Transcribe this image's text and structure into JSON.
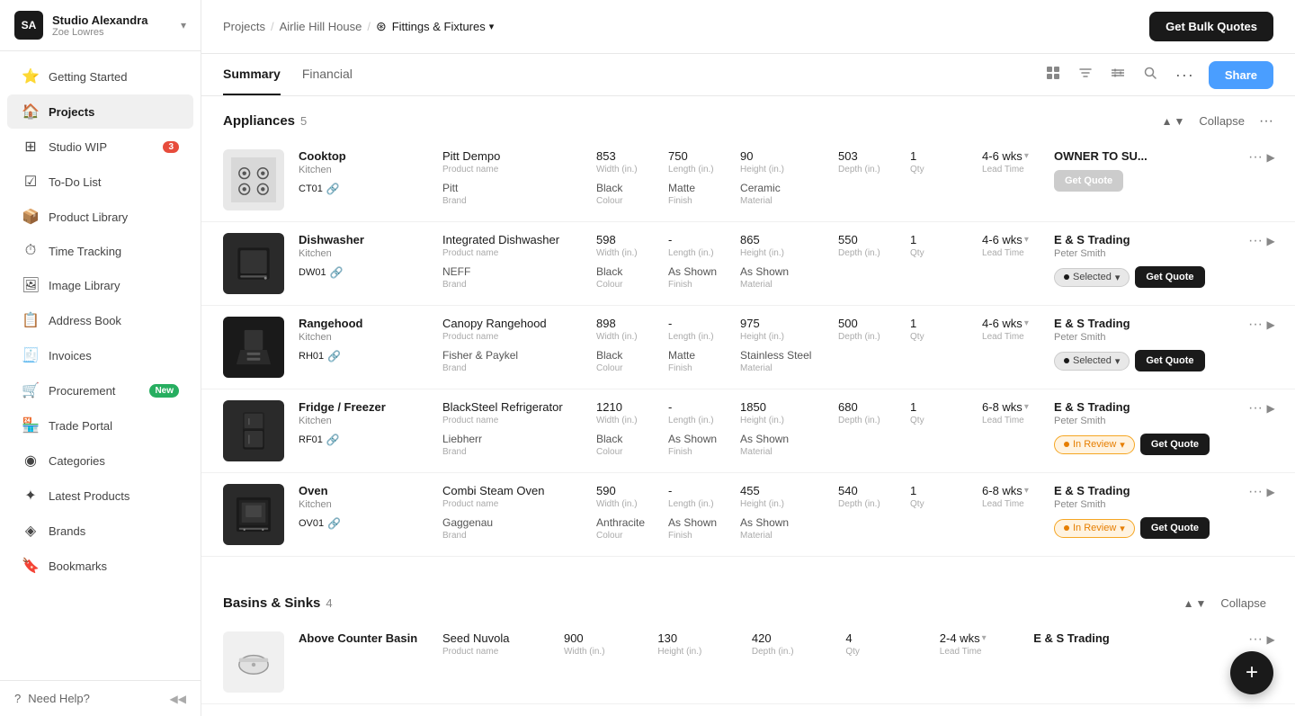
{
  "sidebar": {
    "company": "Studio Alexandra",
    "user": "Zoe Lowres",
    "items": [
      {
        "id": "getting-started",
        "label": "Getting Started",
        "icon": "⭐",
        "badge": null
      },
      {
        "id": "projects",
        "label": "Projects",
        "icon": "🏠",
        "badge": null,
        "active": true
      },
      {
        "id": "studio-wip",
        "label": "Studio WIP",
        "icon": "⊞",
        "badge": "3"
      },
      {
        "id": "todo-list",
        "label": "To-Do List",
        "icon": "☑",
        "badge": null
      },
      {
        "id": "product-library",
        "label": "Product Library",
        "icon": "📦",
        "badge": null
      },
      {
        "id": "time-tracking",
        "label": "Time Tracking",
        "icon": "⏱",
        "badge": null
      },
      {
        "id": "image-library",
        "label": "Image Library",
        "icon": "🖼",
        "badge": null
      },
      {
        "id": "address-book",
        "label": "Address Book",
        "icon": "📋",
        "badge": null
      },
      {
        "id": "invoices",
        "label": "Invoices",
        "icon": "🧾",
        "badge": null
      },
      {
        "id": "procurement",
        "label": "Procurement",
        "icon": "🛒",
        "badge_new": "New"
      },
      {
        "id": "trade-portal",
        "label": "Trade Portal",
        "icon": "🏪",
        "badge": null
      },
      {
        "id": "categories",
        "label": "Categories",
        "icon": "◉",
        "badge": null
      },
      {
        "id": "latest-products",
        "label": "Latest Products",
        "icon": "✦",
        "badge": null
      },
      {
        "id": "brands",
        "label": "Brands",
        "icon": "◈",
        "badge": null
      },
      {
        "id": "bookmarks",
        "label": "Bookmarks",
        "icon": "🔖",
        "badge": null
      }
    ],
    "help": "Need Help?"
  },
  "topbar": {
    "breadcrumb": [
      "Projects",
      "Airlie Hill House"
    ],
    "current_section": "Fittings & Fixtures",
    "bulk_quotes_label": "Get Bulk Quotes"
  },
  "tabs": {
    "items": [
      "Summary",
      "Financial"
    ],
    "active": "Summary"
  },
  "share_label": "Share",
  "sections": [
    {
      "id": "appliances",
      "title": "Appliances",
      "count": 5,
      "products": [
        {
          "id": "CT01",
          "name": "Cooktop",
          "category": "Kitchen",
          "code": "CT01",
          "product_name": "Pitt Dempo",
          "brand": "Pitt",
          "width": "853",
          "length": "750",
          "height": "90",
          "depth": "503",
          "qty": "1",
          "lead_time": "4-6 wks",
          "colour": "Black",
          "finish": "Matte",
          "material": "Ceramic",
          "supplier": "OWNER TO SU...",
          "contact": "",
          "status": null,
          "status_type": "owner",
          "img_type": "cooktop"
        },
        {
          "id": "DW01",
          "name": "Dishwasher",
          "category": "Kitchen",
          "code": "DW01",
          "product_name": "Integrated Dishwasher",
          "brand": "NEFF",
          "width": "598",
          "length": "-",
          "height": "865",
          "depth": "550",
          "qty": "1",
          "lead_time": "4-6 wks",
          "colour": "Black",
          "finish": "As Shown",
          "material": "As Shown",
          "supplier": "E & S Trading",
          "contact": "Peter Smith",
          "status": "Selected",
          "status_type": "selected",
          "img_type": "dishwasher"
        },
        {
          "id": "RH01",
          "name": "Rangehood",
          "category": "Kitchen",
          "code": "RH01",
          "product_name": "Canopy Rangehood",
          "brand": "Fisher & Paykel",
          "width": "898",
          "length": "-",
          "height": "975",
          "depth": "500",
          "qty": "1",
          "lead_time": "4-6 wks",
          "colour": "Black",
          "finish": "Matte",
          "material": "Stainless Steel",
          "supplier": "E & S Trading",
          "contact": "Peter Smith",
          "status": "Selected",
          "status_type": "selected",
          "img_type": "rangehood"
        },
        {
          "id": "RF01",
          "name": "Fridge / Freezer",
          "category": "Kitchen",
          "code": "RF01",
          "product_name": "BlackSteel Refrigerator",
          "brand": "Liebherr",
          "width": "1210",
          "length": "-",
          "height": "1850",
          "depth": "680",
          "qty": "1",
          "lead_time": "6-8 wks",
          "colour": "Black",
          "finish": "As Shown",
          "material": "As Shown",
          "supplier": "E & S Trading",
          "contact": "Peter Smith",
          "status": "In Review",
          "status_type": "in-review",
          "img_type": "fridge"
        },
        {
          "id": "OV01",
          "name": "Oven",
          "category": "Kitchen",
          "code": "OV01",
          "product_name": "Combi Steam Oven",
          "brand": "Gaggenau",
          "width": "590",
          "length": "-",
          "height": "455",
          "depth": "540",
          "qty": "1",
          "lead_time": "6-8 wks",
          "colour": "Anthracite",
          "finish": "As Shown",
          "material": "As Shown",
          "supplier": "E & S Trading",
          "contact": "Peter Smith",
          "status": "In Review",
          "status_type": "in-review",
          "img_type": "oven"
        }
      ]
    },
    {
      "id": "basins-sinks",
      "title": "Basins & Sinks",
      "count": 4,
      "products": [
        {
          "id": "BS01",
          "name": "Above Counter Basin",
          "category": "",
          "code": "",
          "product_name": "Seed Nuvola",
          "brand": "",
          "width": "900",
          "length": "",
          "height": "130",
          "depth": "420",
          "qty": "4",
          "lead_time": "2-4 wks",
          "colour": "",
          "finish": "",
          "material": "",
          "supplier": "E & S Trading",
          "contact": "",
          "status": null,
          "status_type": null,
          "img_type": "basin"
        }
      ]
    }
  ],
  "labels": {
    "width": "Width (in.)",
    "length": "Length (in.)",
    "height": "Height (in.)",
    "depth": "Depth (in.)",
    "qty": "Qty",
    "lead_time": "Lead Time",
    "product_name_label": "Product name",
    "brand_label": "Brand",
    "colour_label": "Colour",
    "finish_label": "Finish",
    "material_label": "Material",
    "collapse": "Collapse",
    "get_quote": "Get Quote"
  }
}
